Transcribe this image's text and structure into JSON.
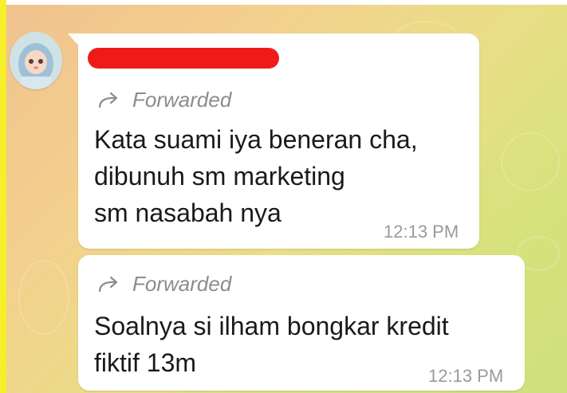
{
  "messages": [
    {
      "forward_label": "Forwarded",
      "lines": [
        "Kata suami iya beneran cha,",
        "dibunuh sm marketing",
        "sm nasabah nya"
      ],
      "time": "12:13 PM"
    },
    {
      "forward_label": "Forwarded",
      "lines": [
        "Soalnya si ilham bongkar kredit",
        "fiktif 13m"
      ],
      "time": "12:13 PM"
    }
  ],
  "colors": {
    "name_redaction": "#ef1b1b",
    "bubble": "#ffffff",
    "forward_text": "#8c8c8c",
    "time_text": "#9a9a9a"
  },
  "icons": [
    "forward-arrow-icon",
    "avatar"
  ]
}
